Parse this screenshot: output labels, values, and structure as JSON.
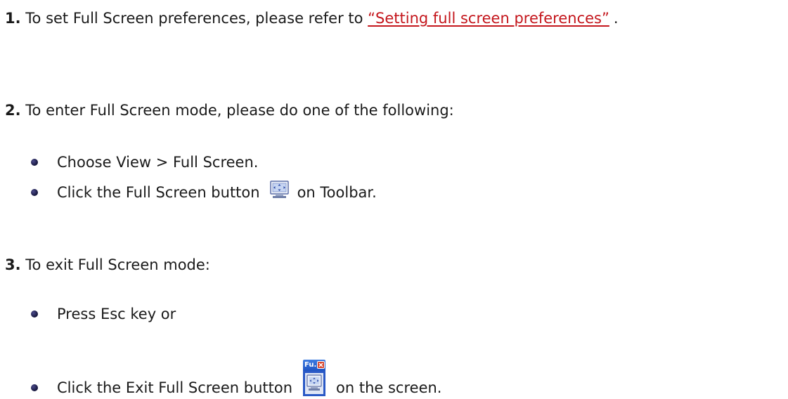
{
  "step1": {
    "number": "1.",
    "text_before": "To set Full Screen preferences, please refer to",
    "link": "“Setting full screen preferences”",
    "text_after": "."
  },
  "step2": {
    "number": "2.",
    "text": "To enter Full Screen mode, please do one of the following:",
    "bullets": [
      {
        "text": "Choose View > Full Screen."
      },
      {
        "text_before": "Click the Full Screen button",
        "text_after": "on Toolbar.",
        "icon": "full-screen-icon"
      }
    ]
  },
  "step3": {
    "number": "3.",
    "text": "To exit Full Screen mode:",
    "bullets": [
      {
        "text": "Press Esc key or"
      },
      {
        "text_before": "Click the Exit Full Screen button",
        "text_after": "on the screen.",
        "icon": "exit-full-screen-icon",
        "icon_title": "Fu..."
      }
    ]
  },
  "colors": {
    "link": "#c4161c",
    "bullet": "#14143a",
    "text": "#1a1a1a"
  }
}
